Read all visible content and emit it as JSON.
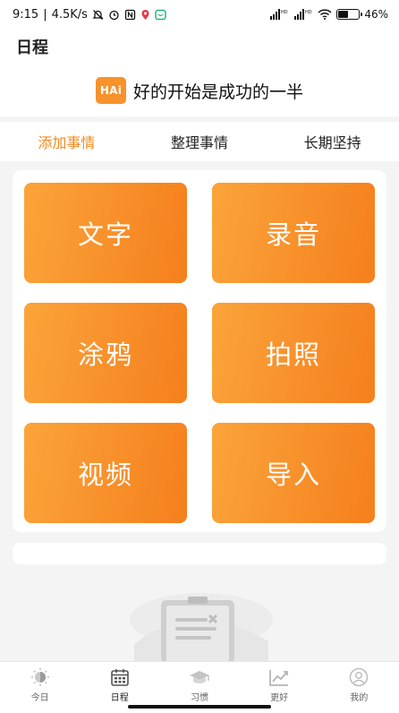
{
  "status_bar": {
    "time": "9:15",
    "network_speed": "4.5K/s",
    "separator": "|",
    "battery_percent": "46%",
    "battery_level": 0.46
  },
  "app_bar": {
    "title": "日程"
  },
  "banner": {
    "logo_text": "HAi",
    "slogan": "好的开始是成功的一半"
  },
  "tabs": [
    {
      "label": "添加事情",
      "active": true
    },
    {
      "label": "整理事情",
      "active": false
    },
    {
      "label": "长期坚持",
      "active": false
    }
  ],
  "actions": [
    {
      "label": "文字"
    },
    {
      "label": "录音"
    },
    {
      "label": "涂鸦"
    },
    {
      "label": "拍照"
    },
    {
      "label": "视频"
    },
    {
      "label": "导入"
    }
  ],
  "bottom_nav": [
    {
      "label": "今日",
      "icon": "day-icon",
      "active": false
    },
    {
      "label": "日程",
      "icon": "calendar-icon",
      "active": true
    },
    {
      "label": "习惯",
      "icon": "graduation-cap-icon",
      "active": false
    },
    {
      "label": "更好",
      "icon": "trend-chart-icon",
      "active": false
    },
    {
      "label": "我的",
      "icon": "profile-icon",
      "active": false
    }
  ],
  "colors": {
    "accent": "#f28a22",
    "tile_gradient_start": "#fba43a",
    "tile_gradient_end": "#f57f1d"
  }
}
